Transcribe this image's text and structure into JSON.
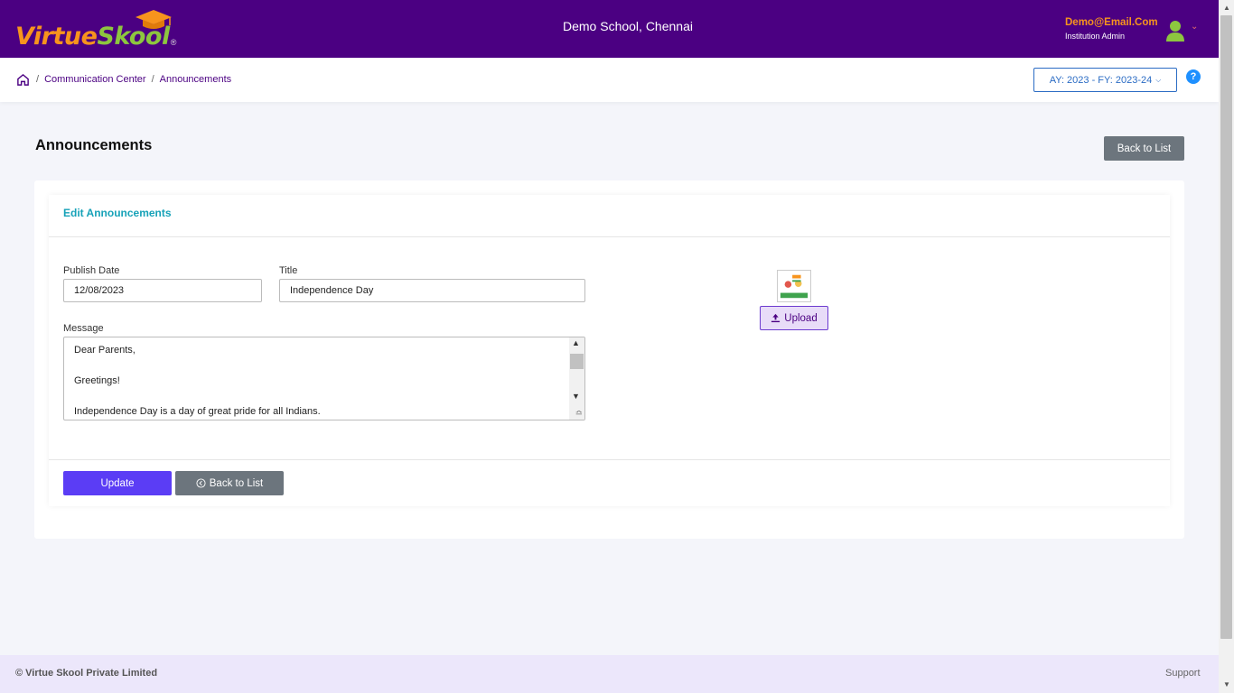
{
  "brand": {
    "part1": "Virtue",
    "part2": "Skool",
    "reg": "®"
  },
  "header": {
    "school": "Demo School, Chennai",
    "user_email": "Demo@Email.Com",
    "user_role": "Institution Admin"
  },
  "breadcrumb": {
    "items": [
      "Communication Center",
      "Announcements"
    ],
    "sep": "/"
  },
  "year_selector": {
    "label": "AY: 2023 - FY: 2023-24"
  },
  "help": {
    "label": "?"
  },
  "page": {
    "title": "Announcements",
    "back_top": "Back to List"
  },
  "form": {
    "heading": "Edit Announcements",
    "publish_date_label": "Publish Date",
    "publish_date_value": "12/08/2023",
    "title_label": "Title",
    "title_value": "Independence Day",
    "message_label": "Message",
    "message_lines": [
      "Dear Parents,",
      "",
      "Greetings!",
      "",
      "Independence Day is a day of great pride for all Indians."
    ],
    "upload_label": "Upload",
    "update_label": "Update",
    "back_label": "Back to List"
  },
  "footer": {
    "copyright": "© Virtue Skool Private Limited",
    "support": "Support"
  }
}
